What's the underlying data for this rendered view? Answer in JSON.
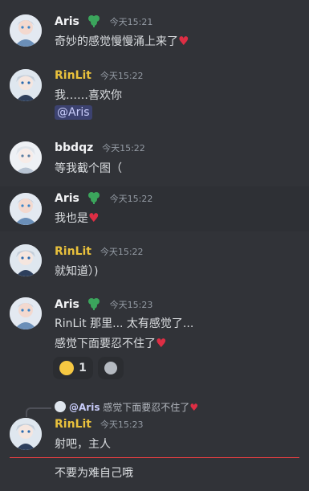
{
  "messages": [
    {
      "author": "Aris",
      "timestamp": "今天15:21",
      "lines": [
        "奇妙的感觉慢慢涌上来了"
      ]
    },
    {
      "author": "RinLit",
      "timestamp": "今天15:22",
      "lines": [
        "我……喜欢你"
      ],
      "mention": "@Aris"
    },
    {
      "author": "bbdqz",
      "timestamp": "今天15:22",
      "lines": [
        "等我截个图（"
      ]
    },
    {
      "author": "Aris",
      "timestamp": "今天15:22",
      "lines": [
        "我也是"
      ]
    },
    {
      "author": "RinLit",
      "timestamp": "今天15:22",
      "lines": [
        "就知道）)"
      ]
    },
    {
      "author": "Aris",
      "timestamp": "今天15:23",
      "lines": [
        "RinLit 那里... 太有感觉了...",
        "感觉下面要忍不住了"
      ],
      "reactions": [
        {
          "emoji": "face-savoring-food",
          "count": "1"
        },
        {
          "emoji": "add-reaction-icon"
        }
      ]
    },
    {
      "author": "RinLit",
      "timestamp": "今天15:23",
      "lines": [
        "射吧，主人"
      ],
      "reply": {
        "author": "@Aris",
        "text": "感觉下面要忍不住了"
      }
    },
    {
      "lines": [
        "不要为难自己哦"
      ]
    }
  ],
  "icons": {
    "heart": "red-heart-emoji",
    "badge": "clover-badge-icon"
  },
  "colors": {
    "background": "#313338",
    "gold_name": "#e9c13c",
    "mention_bg": "#3c4270",
    "divider": "#f23f42",
    "heart": "#dd2e44"
  }
}
